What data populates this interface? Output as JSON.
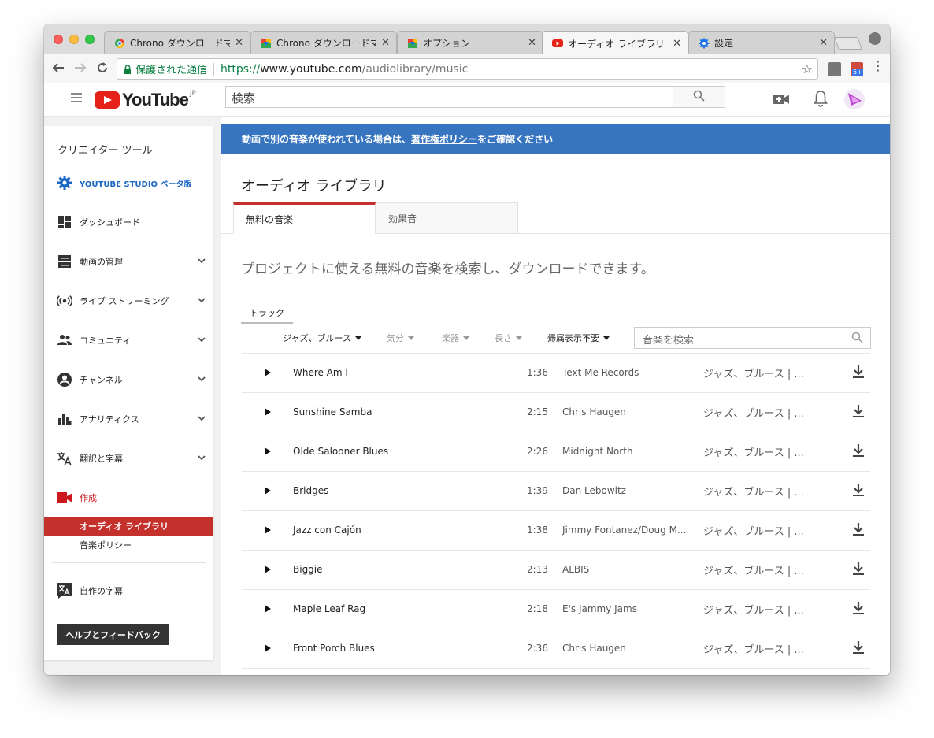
{
  "browser": {
    "tabs": [
      {
        "label": "Chrono ダウンロードマネ",
        "icon": "chrono-icon",
        "active": false
      },
      {
        "label": "Chrono ダウンロードマネ",
        "icon": "chrono-download-icon",
        "active": false
      },
      {
        "label": "オプション",
        "icon": "chrono-download-icon",
        "active": false
      },
      {
        "label": "オーディオ ライブラリ - Y",
        "icon": "youtube-icon",
        "active": true
      },
      {
        "label": "設定",
        "icon": "gear-icon",
        "active": false
      }
    ],
    "close_glyph": "✕",
    "secure_label": "保護された通信",
    "url_scheme": "https://",
    "url_host": "www.youtube.com",
    "url_path": "/audiolibrary/music",
    "extension_badge": "5+"
  },
  "youtube": {
    "logo_text": "YouTube",
    "region": "JP",
    "search_placeholder": "検索"
  },
  "sidebar": {
    "title": "クリエイター ツール",
    "studio": "YOUTUBE STUDIO ベータ版",
    "items": [
      {
        "label": "ダッシュボード",
        "icon": "dashboard-icon"
      },
      {
        "label": "動画の管理",
        "icon": "video-manager-icon"
      },
      {
        "label": "ライブ ストリーミング",
        "icon": "live-streaming-icon"
      },
      {
        "label": "コミュニティ",
        "icon": "community-icon"
      },
      {
        "label": "チャンネル",
        "icon": "channel-icon"
      },
      {
        "label": "アナリティクス",
        "icon": "analytics-icon"
      },
      {
        "label": "翻訳と字幕",
        "icon": "translate-icon"
      },
      {
        "label": "作成",
        "icon": "create-icon"
      }
    ],
    "sub_items": [
      {
        "label": "オーディオ ライブラリ",
        "selected": true
      },
      {
        "label": "音楽ポリシー",
        "selected": false
      }
    ],
    "own_captions": "自作の字幕",
    "help_button": "ヘルプとフィードバック"
  },
  "main": {
    "banner_prefix": "動画で別の音楽が使われている場合は、",
    "banner_link": "著作権ポリシー",
    "banner_suffix": "をご確認ください",
    "page_title": "オーディオ ライブラリ",
    "tabs": [
      "無料の音楽",
      "効果音"
    ],
    "intro": "プロジェクトに使える無料の音楽を検索し、ダウンロードできます。",
    "subtab": "トラック",
    "filters": [
      "ジャズ、ブルース",
      "気分",
      "楽器",
      "長さ",
      "帰属表示不要"
    ],
    "music_search_placeholder": "音楽を検索",
    "tracks": [
      {
        "title": "Where Am I",
        "duration": "1:36",
        "artist": "Text Me Records",
        "genre": "ジャズ、ブルース | ..."
      },
      {
        "title": "Sunshine Samba",
        "duration": "2:15",
        "artist": "Chris Haugen",
        "genre": "ジャズ、ブルース | ..."
      },
      {
        "title": "Olde Salooner Blues",
        "duration": "2:26",
        "artist": "Midnight North",
        "genre": "ジャズ、ブルース | ..."
      },
      {
        "title": "Bridges",
        "duration": "1:39",
        "artist": "Dan Lebowitz",
        "genre": "ジャズ、ブルース | ..."
      },
      {
        "title": "Jazz con Cajón",
        "duration": "1:38",
        "artist": "Jimmy Fontanez/Doug M...",
        "genre": "ジャズ、ブルース | ..."
      },
      {
        "title": "Biggie",
        "duration": "2:13",
        "artist": "ALBIS",
        "genre": "ジャズ、ブルース | ..."
      },
      {
        "title": "Maple Leaf Rag",
        "duration": "2:18",
        "artist": "E's Jammy Jams",
        "genre": "ジャズ、ブルース | ..."
      },
      {
        "title": "Front Porch Blues",
        "duration": "2:36",
        "artist": "Chris Haugen",
        "genre": "ジャズ、ブルース | ..."
      }
    ]
  },
  "colors": {
    "brand_red": "#e62117",
    "accent_red": "#c4302b",
    "banner_blue": "#3775c1",
    "studio_blue": "#1a67c4",
    "secure_green": "#0b8043"
  }
}
